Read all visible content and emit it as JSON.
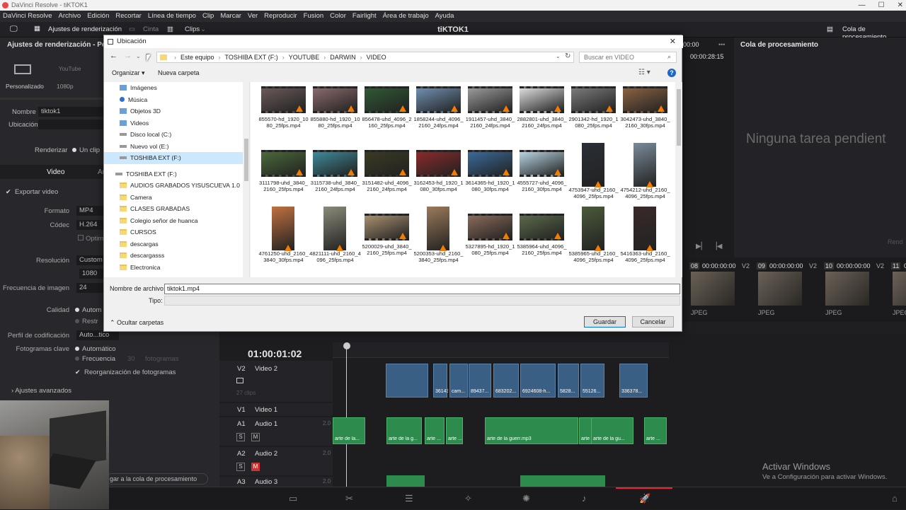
{
  "window": {
    "title": "DaVinci Resolve - tiKTOK1"
  },
  "menu": [
    "DaVinci Resolve",
    "Archivo",
    "Edición",
    "Recortar",
    "Línea de tiempo",
    "Clip",
    "Marcar",
    "Ver",
    "Reproducir",
    "Fusion",
    "Color",
    "Fairlight",
    "Área de trabajo",
    "Ayuda"
  ],
  "toolbar": {
    "render_settings": "Ajustes de renderización",
    "tape": "Cinta",
    "clips": "Clips",
    "project_title": "tiKTOK1",
    "render_queue": "Cola de procesamiento"
  },
  "left_panel": {
    "header": "Ajustes de renderización - Perso",
    "preset_custom": "Personalizado",
    "preset_1080": "1080p",
    "preset_youtube": "YouTube",
    "name_label": "Nombre",
    "name_value": "tiktok1",
    "location_label": "Ubicación",
    "render_label": "Renderizar",
    "render_opt": "Un clip",
    "tab_video": "Video",
    "tab_audio": "Au",
    "export_video": "Exportar video",
    "format_label": "Formato",
    "format_value": "MP4",
    "codec_label": "Códec",
    "codec_value": "H.264",
    "codec_opt": "Optim",
    "resolution_label": "Resolución",
    "resolution_value": "Custom",
    "resolution_value2": "1080",
    "framerate_label": "Frecuencia de imagen",
    "framerate_value": "24",
    "quality_label": "Calidad",
    "quality_auto": "Autom",
    "quality_restrict": "Restr",
    "encoding_label": "Perfil de codificación",
    "encoding_value": "Auto...tico",
    "keyframes_label": "Fotogramas clave",
    "keyframes_auto": "Automático",
    "keyframes_freq": "Frecuencia",
    "keyframes_num": "30",
    "keyframes_unit": "fotogramas",
    "reorder": "Reorganización de fotogramas",
    "advanced": "Ajustes avanzados",
    "add_queue": "gar a la cola de procesamiento"
  },
  "viewer": {
    "timecode_a": "00:00",
    "timecode_b": "00:00:28:15"
  },
  "right_panel": {
    "title": "Cola de procesamiento",
    "empty": "Ninguna tarea pendient",
    "render_btn": "Rend"
  },
  "clip_strip": [
    {
      "num": "08",
      "tc": "00:00:00:00",
      "track": "V2",
      "fmt": "JPEG"
    },
    {
      "num": "09",
      "tc": "00:00:00:00",
      "track": "V2",
      "fmt": "JPEG"
    },
    {
      "num": "10",
      "tc": "00:00:00:00",
      "track": "V2",
      "fmt": "JPEG"
    },
    {
      "num": "11",
      "tc": "00",
      "track": "",
      "fmt": "JPEG"
    }
  ],
  "timeline": {
    "timecode": "01:00:01:02",
    "tracks": [
      {
        "id": "V2",
        "name": "Video 2",
        "sub": "27 clips"
      },
      {
        "id": "V1",
        "name": "Video 1",
        "sub": ""
      },
      {
        "id": "A1",
        "name": "Audio 1",
        "sub": "2.0"
      },
      {
        "id": "A2",
        "name": "Audio 2",
        "sub": "2.0"
      },
      {
        "id": "A3",
        "name": "Audio 3",
        "sub": "2.0"
      }
    ],
    "video_clips": [
      "3614365-hd...",
      "cam...",
      "89437...",
      "683202...",
      "6924608-h...",
      "5828...",
      "55126...",
      "336378..."
    ],
    "audio_clips": [
      "arte de la...",
      "arte de la g...",
      "arte ...",
      "arte ...",
      "arte de la guerr.mp3",
      "arte ...",
      "arte de la gu...",
      "arte ..."
    ]
  },
  "activation": {
    "line1": "Activar Windows",
    "line2": "Ve a Configuración para activar Windows."
  },
  "dialog": {
    "title": "Ubicación",
    "breadcrumb": [
      "Este equipo",
      "TOSHIBA EXT (F:)",
      "YOUTUBE",
      "DARWIN",
      "VIDEO"
    ],
    "search_placeholder": "Buscar en VIDEO",
    "organize": "Organizar",
    "new_folder": "Nueva carpeta",
    "nav": [
      {
        "label": "Imágenes",
        "type": "lib"
      },
      {
        "label": "Música",
        "type": "music"
      },
      {
        "label": "Objetos 3D",
        "type": "lib"
      },
      {
        "label": "Videos",
        "type": "lib"
      },
      {
        "label": "Disco local (C:)",
        "type": "drive"
      },
      {
        "label": "Nuevo vol (E:)",
        "type": "drive"
      },
      {
        "label": "TOSHIBA EXT (F:)",
        "type": "drive-sel"
      },
      {
        "label": "",
        "type": "gap"
      },
      {
        "label": "TOSHIBA EXT (F:)",
        "type": "drive"
      },
      {
        "label": "AUDIOS GRABADOS YISUSCUEVA 1.0",
        "type": "folder"
      },
      {
        "label": "Camera",
        "type": "folder"
      },
      {
        "label": "CLASES GRABADAS",
        "type": "folder"
      },
      {
        "label": "Colegio señor de huanca",
        "type": "folder"
      },
      {
        "label": "CURSOS",
        "type": "folder"
      },
      {
        "label": "descargas",
        "type": "folder"
      },
      {
        "label": "descargasss",
        "type": "folder"
      },
      {
        "label": "Electronica",
        "type": "folder"
      }
    ],
    "files": [
      {
        "name": "855570-hd_1920_1080_25fps.mp4",
        "c": "#6a5a58"
      },
      {
        "name": "855880-hd_1920_1080_25fps.mp4",
        "c": "#8a6a6a"
      },
      {
        "name": "856478-uhd_4096_2160_25fps.mp4",
        "c": "#2f5a34"
      },
      {
        "name": "1858244-uhd_4096_2160_24fps.mp4",
        "c": "#6f8fb0"
      },
      {
        "name": "1911457-uhd_3840_2160_24fps.mp4",
        "c": "#9a9a9a"
      },
      {
        "name": "2882801-uhd_3840_2160_24fps.mp4",
        "c": "#dcdcdc"
      },
      {
        "name": "2901342-hd_1920_1080_25fps.mp4",
        "c": "#7a7a7a"
      },
      {
        "name": "3042473-uhd_3840_2160_30fps.mp4",
        "c": "#8a6242"
      },
      {
        "name": "3111798-uhd_3840_2160_25fps.mp4",
        "c": "#4a6a3a"
      },
      {
        "name": "3115738-uhd_3840_2160_24fps.mp4",
        "c": "#3e8a9a"
      },
      {
        "name": "3151482-uhd_4096_2160_24fps.mp4",
        "c": "#3a3a22"
      },
      {
        "name": "3162453-hd_1920_1080_30fps.mp4",
        "c": "#8a2a2a"
      },
      {
        "name": "3614365-hd_1920_1080_30fps.mp4",
        "c": "#3a6a9a"
      },
      {
        "name": "4555727-uhd_4096_2160_30fps.mp4",
        "c": "#b8d4e2"
      },
      {
        "name": "4753947-uhd_2160_4096_25fps.mp4",
        "c": "#2a2e36",
        "tall": true
      },
      {
        "name": "4754212-uhd_2160_4096_25fps.mp4",
        "c": "#7a8a9a",
        "tall": true
      },
      {
        "name": "4761250-uhd_2160_3840_30fps.mp4",
        "c": "#c07040",
        "tall": true
      },
      {
        "name": "4821111-uhd_2160_4096_25fps.mp4",
        "c": "#8a8a7a",
        "tall": true
      },
      {
        "name": "5200029-uhd_3840_2160_25fps.mp4",
        "c": "#a89070"
      },
      {
        "name": "5200353-uhd_2160_3840_25fps.mp4",
        "c": "#9a7a5a",
        "tall": true
      },
      {
        "name": "5327895-hd_1920_1080_25fps.mp4",
        "c": "#8a6a5a"
      },
      {
        "name": "5385964-uhd_4096_2160_25fps.mp4",
        "c": "#5a6a4a"
      },
      {
        "name": "5385965-uhd_2160_4096_25fps.mp4",
        "c": "#4a5a3a",
        "tall": true
      },
      {
        "name": "5416363-uhd_2160_4096_25fps.mp4",
        "c": "#3a2a2a",
        "tall": true
      }
    ],
    "filename_label": "Nombre de archivo:",
    "filename_value": "tiktok1.mp4",
    "type_label": "Tipo:",
    "hide_folders": "Ocultar carpetas",
    "save": "Guardar",
    "cancel": "Cancelar"
  }
}
